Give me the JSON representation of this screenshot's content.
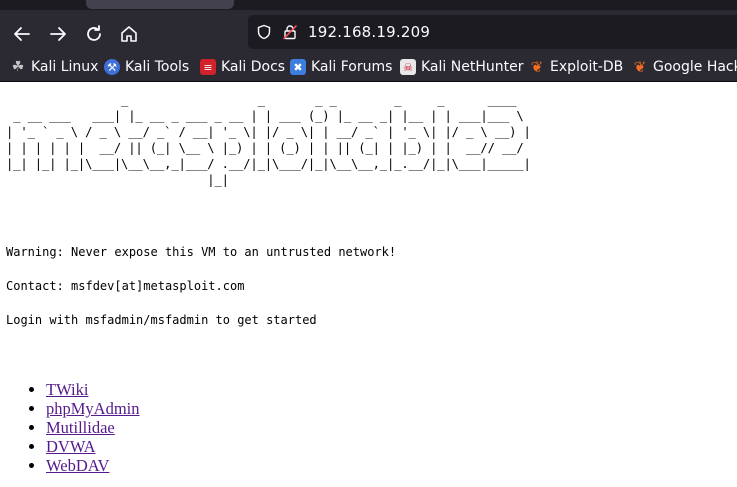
{
  "browser": {
    "url": "192.168.19.209",
    "bookmarks": [
      {
        "label": "Kali Linux",
        "icon": "kali-dragon-icon"
      },
      {
        "label": "Kali Tools",
        "icon": "kali-tools-icon"
      },
      {
        "label": "Kali Docs",
        "icon": "kali-docs-icon"
      },
      {
        "label": "Kali Forums",
        "icon": "kali-forums-icon"
      },
      {
        "label": "Kali NetHunter",
        "icon": "nethunter-icon"
      },
      {
        "label": "Exploit-DB",
        "icon": "exploit-db-icon"
      },
      {
        "label": "Google Hacki",
        "icon": "ghdb-icon"
      }
    ]
  },
  "page": {
    "banner": "                _                  _       _ _        _     _      ____  \n _ __ ___   ___| |_ __ _ ___ _ __ | | ___ (_) |_ __ _| |__ | | ___|___ \\ \n| '_ ` _ \\ / _ \\ __/ _` / __| '_ \\| |/ _ \\| | __/ _` | '_ \\| |/ _ \\ __) |\n| | | | | |  __/ || (_| \\__ \\ |_) | | (_) | | || (_| | |_) | |  __// __/ \n|_| |_| |_|\\___|\\__\\__,_|___/ .__/|_|\\___/|_|\\__\\__,_|_.__/|_|\\___|_____|\n                            |_|",
    "warning": "Warning: Never expose this VM to an untrusted network!",
    "contact": "Contact: msfdev[at]metasploit.com",
    "login": "Login with msfadmin/msfadmin to get started",
    "links": [
      "TWiki",
      "phpMyAdmin",
      "Mutillidae",
      "DVWA",
      "WebDAV"
    ]
  }
}
